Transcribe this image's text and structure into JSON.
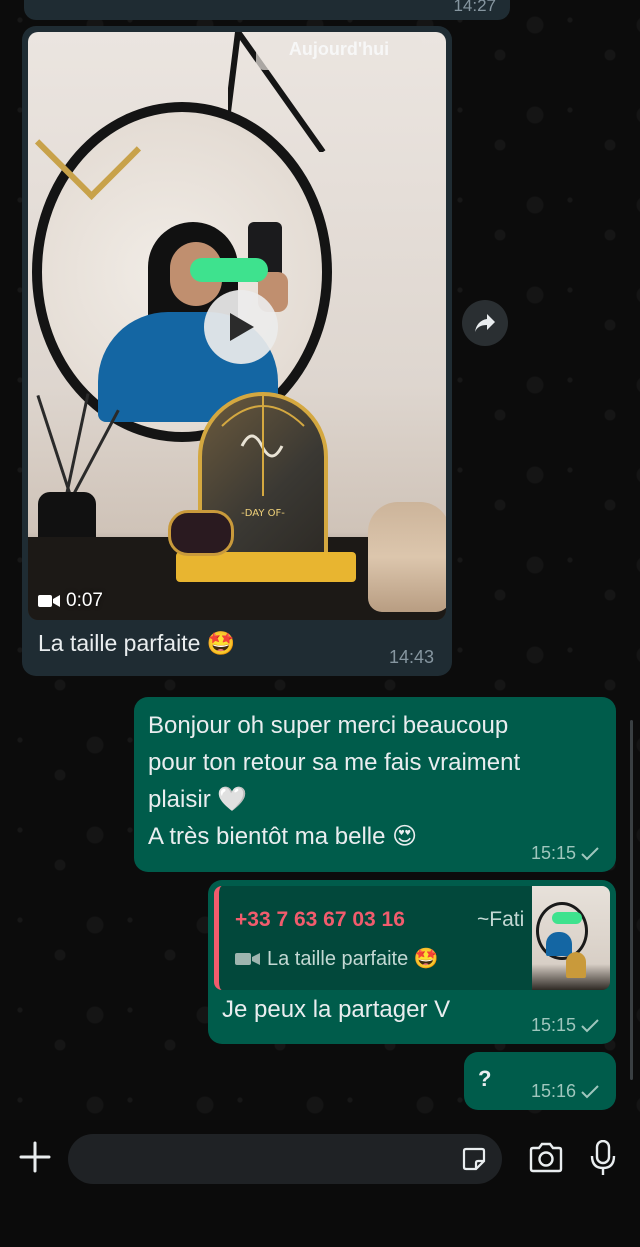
{
  "previous_message": {
    "time": "14:27"
  },
  "date_chip": "Aujourd'hui",
  "incoming": {
    "video_duration": "0:07",
    "plaque_text": "-DAY OF-",
    "caption": "La taille parfaite 🤩",
    "time": "14:43"
  },
  "outgoing": [
    {
      "lines": [
        "Bonjour oh super merci beaucoup",
        "pour ton retour sa me fais vraiment",
        "plaisir 🤍",
        "A très bientôt ma belle 😍"
      ],
      "time": "15:15",
      "status": "sent"
    },
    {
      "quote": {
        "author": "+33 7 63 67 03 16",
        "alias": "~Fati",
        "preview": "La taille parfaite 🤩"
      },
      "text": "Je peux la partager V",
      "time": "15:15",
      "status": "sent"
    },
    {
      "text": "?",
      "time": "15:16",
      "status": "sent"
    }
  ],
  "colors": {
    "incoming_bubble": "#1f2c33",
    "outgoing_bubble": "#005c4b",
    "quote_accent": "#f15c6d",
    "timestamp": "#8696a0"
  },
  "icons": {
    "play": "play-icon",
    "video": "video-camera-icon",
    "forward": "forward-icon",
    "plus": "plus-icon",
    "sticker": "sticker-icon",
    "camera": "camera-icon",
    "mic": "microphone-icon",
    "tick": "single-check-icon"
  }
}
